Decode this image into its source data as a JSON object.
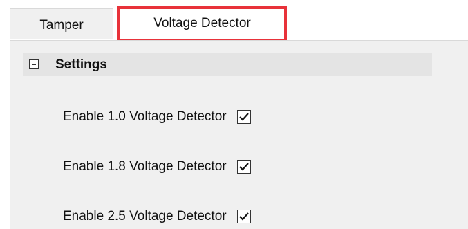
{
  "tabs": [
    {
      "label": "Tamper",
      "active": false
    },
    {
      "label": "Voltage Detector",
      "active": true
    }
  ],
  "highlight_color": "#e8323a",
  "section": {
    "title": "Settings",
    "icon": "collapse-minus-icon",
    "collapsed": false
  },
  "options": [
    {
      "label": "Enable 1.0 Voltage Detector",
      "checked": true
    },
    {
      "label": "Enable 1.8 Voltage Detector",
      "checked": true
    },
    {
      "label": "Enable 2.5 Voltage Detector",
      "checked": true
    }
  ]
}
